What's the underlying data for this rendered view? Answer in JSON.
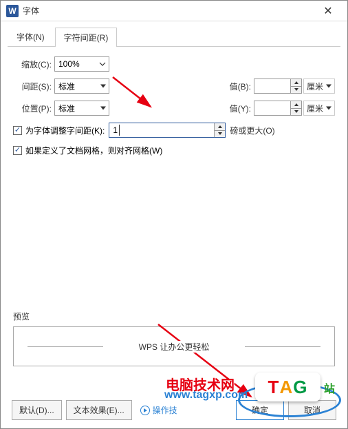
{
  "window": {
    "title": "字体"
  },
  "tabs": {
    "font": "字体(N)",
    "spacing": "字符间距(R)"
  },
  "scale": {
    "label": "缩放(C):",
    "value": "100%"
  },
  "spacing": {
    "label": "间距(S):",
    "value": "标准",
    "valB_label": "值(B):",
    "valB": "",
    "unitB": "厘米"
  },
  "position": {
    "label": "位置(P):",
    "value": "标准",
    "valY_label": "值(Y):",
    "valY": "",
    "unitY": "厘米"
  },
  "kerning": {
    "checkbox_label": "为字体调整字间距(K):",
    "value": "1",
    "trail": "磅或更大(O)"
  },
  "grid": {
    "checkbox_label": "如果定义了文档网格，则对齐网格(W)"
  },
  "preview": {
    "title": "预览",
    "text": "WPS 让办公更轻松"
  },
  "footer": {
    "default_btn": "默认(D)...",
    "effects_btn": "文本效果(E)...",
    "hint": "操作技",
    "ok": "确定",
    "cancel": "取消"
  },
  "overlay": {
    "wm_text": "电脑技术网",
    "wm_url": "www.tagxp.com",
    "tag": "TAG",
    "extra": "站"
  }
}
